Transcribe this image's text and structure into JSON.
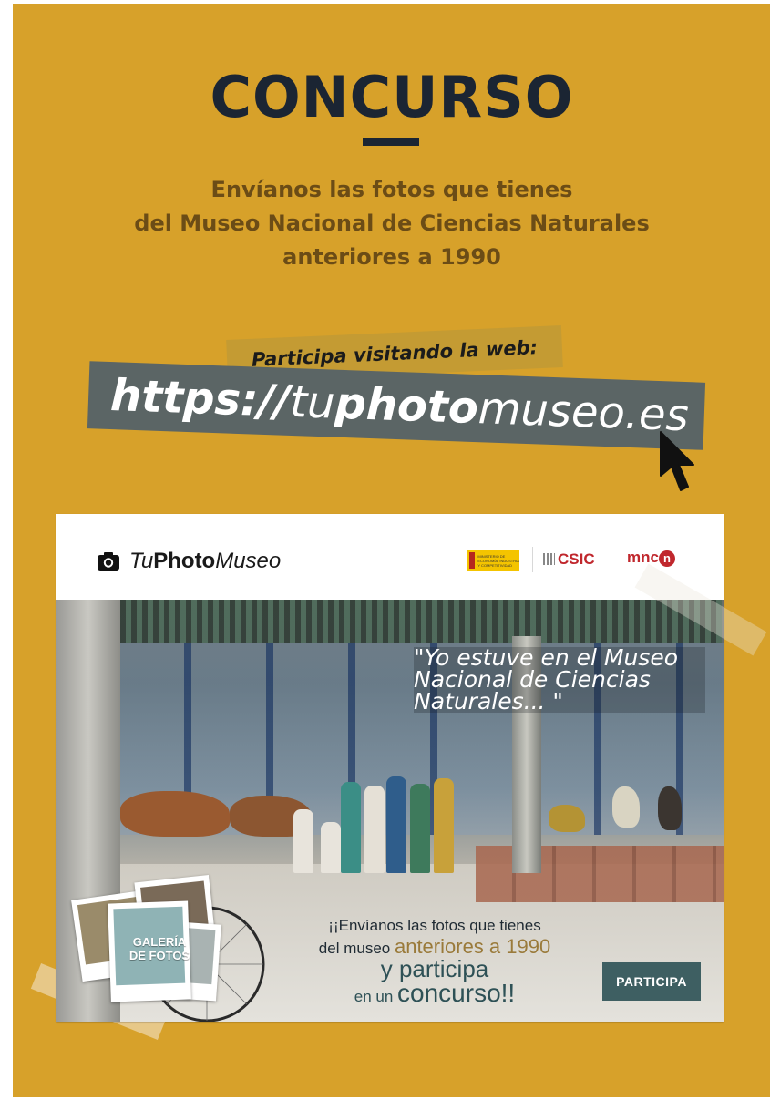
{
  "title": "CONCURSO",
  "subtitle": {
    "line1": "Envíanos las fotos que tienes",
    "line2": "del Museo Nacional de Ciencias Naturales",
    "line3": "anteriores a 1990"
  },
  "cta": {
    "label": "Participa visitando la web:",
    "url_scheme": "https://",
    "url_part1": "tu",
    "url_part2": "photo",
    "url_part3": "museo.es"
  },
  "card": {
    "brand": {
      "part1": "Tu",
      "part2": "Photo",
      "part3": "Museo"
    },
    "logos": {
      "ministerio": "MINISTERIO DE ECONOMÍA, INDUSTRIA Y COMPETITIVIDAD",
      "csic": "CSIC",
      "mncn_prefix": "mnc",
      "mncn_suffix": "n"
    },
    "quote": "\"Yo estuve en el Museo Nacional de Ciencias Naturales... \"",
    "gallery_label_line1": "GALERÍA",
    "gallery_label_line2": "DE FOTOS",
    "promo": {
      "line1": "¡¡Envíanos las fotos que tienes",
      "line2_prefix": "del museo ",
      "line2_highlight": "anteriores a 1990",
      "line3": "y participa",
      "line4_prefix": "en un ",
      "line4_highlight": "concurso",
      "line4_suffix": "!!"
    },
    "button": "PARTICIPA"
  },
  "colors": {
    "background": "#d7a12a",
    "title": "#1b2533",
    "subtitle": "#6b4c16",
    "url_box": "#5b6565",
    "button": "#3e5f62"
  }
}
